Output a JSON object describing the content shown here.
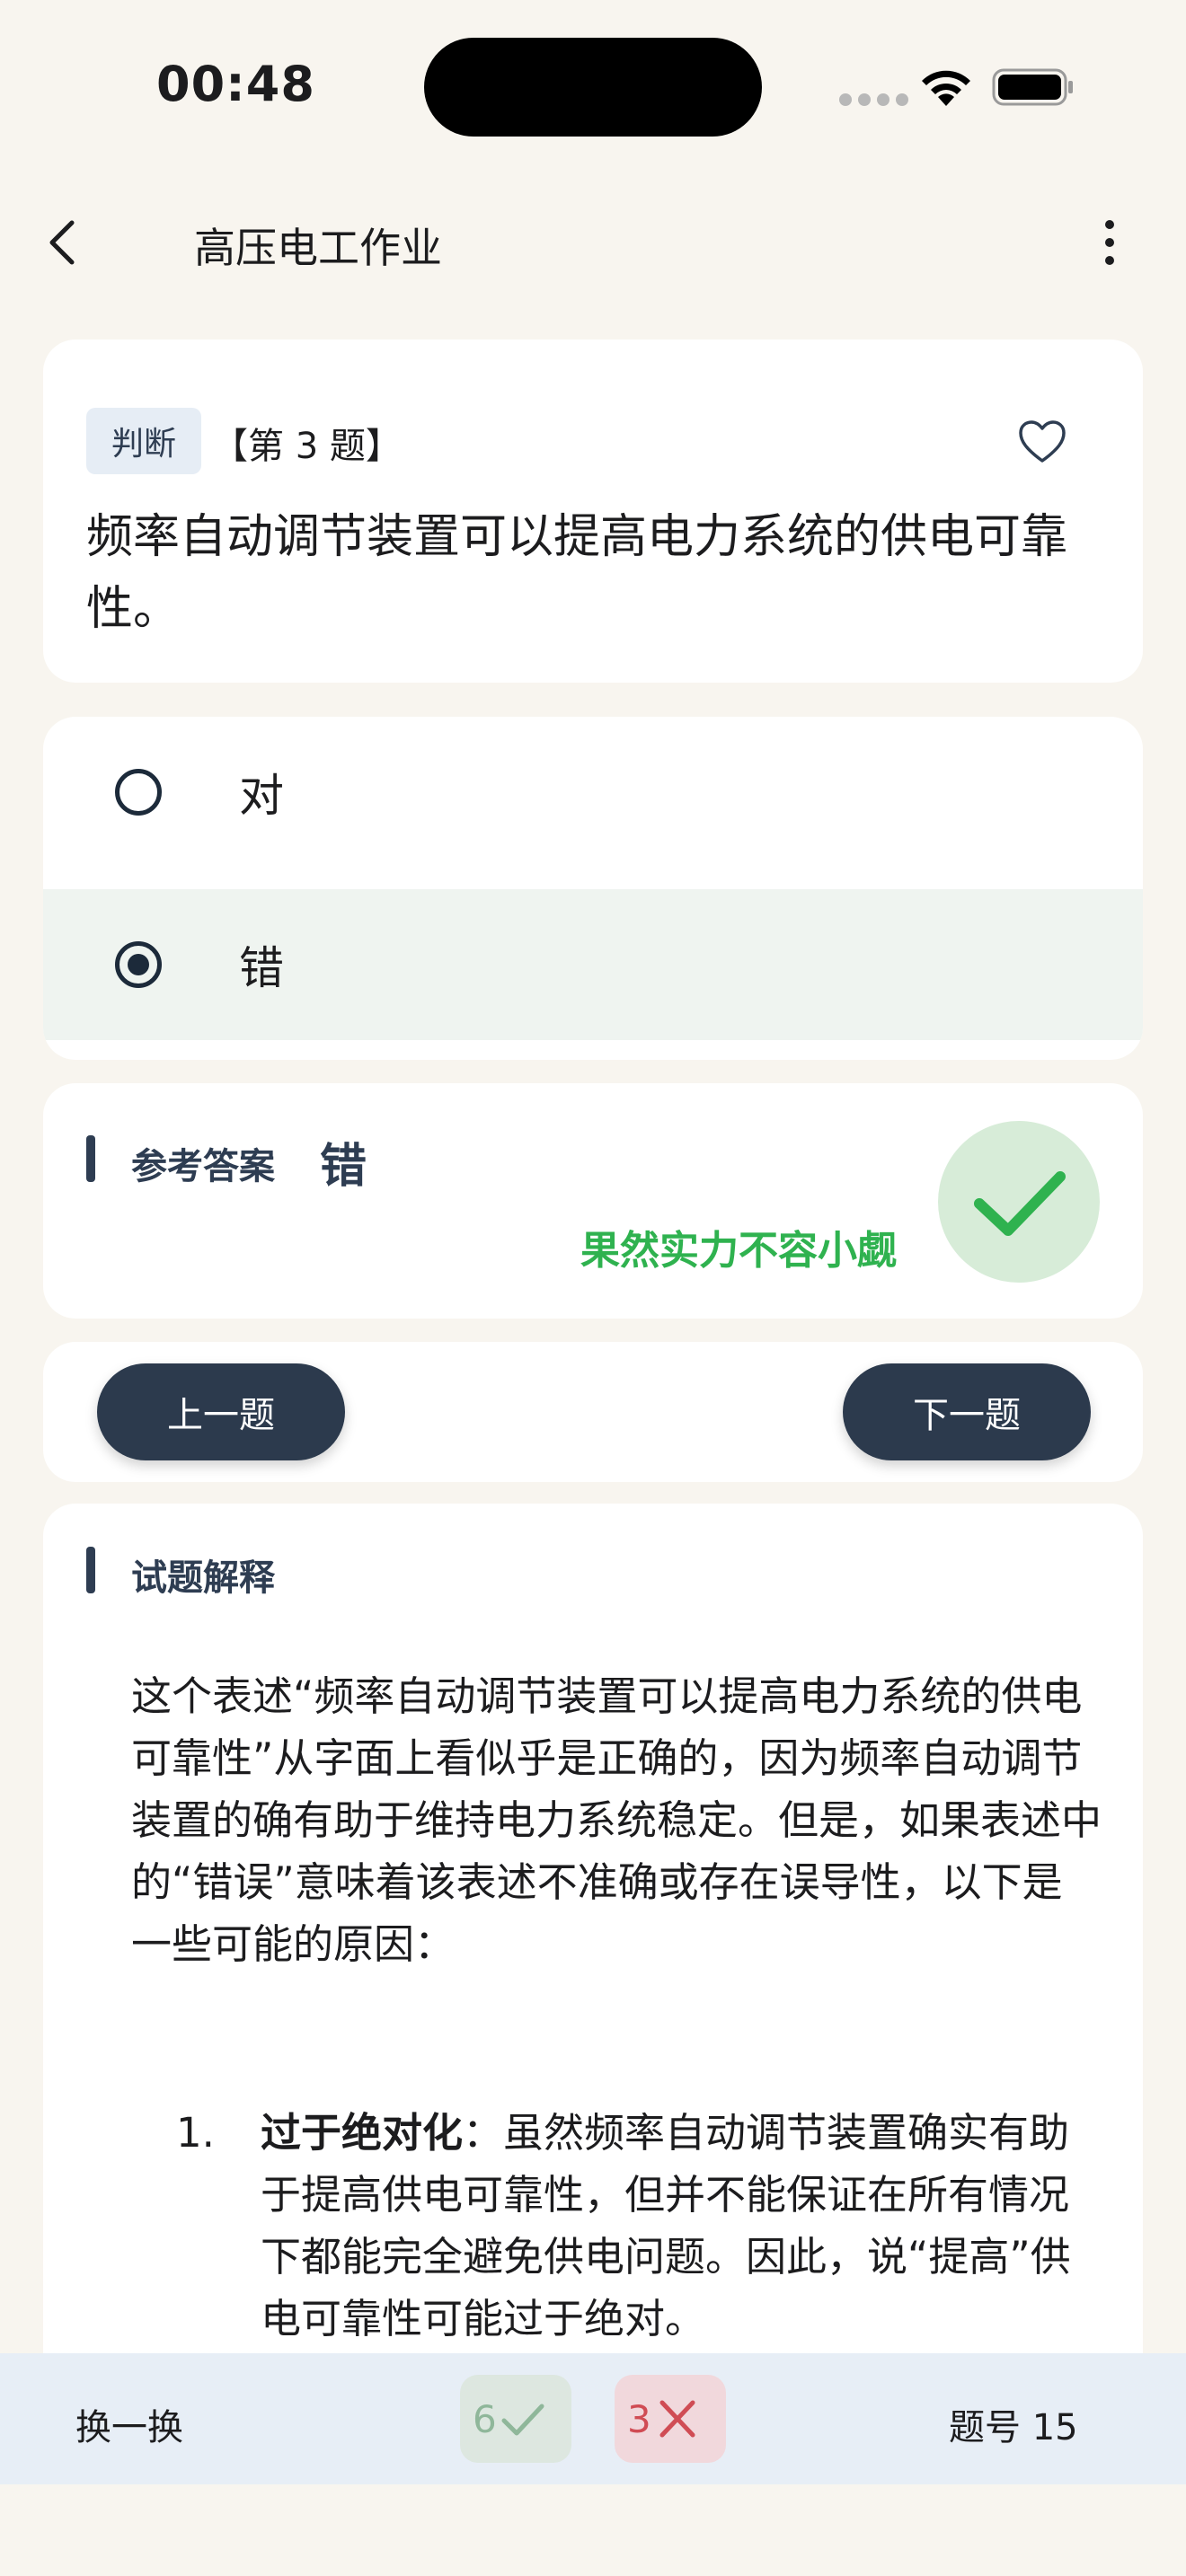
{
  "status": {
    "time": "00:48"
  },
  "header": {
    "title": "高压电工作业"
  },
  "question": {
    "type_tag": "判断",
    "number_label": "【第 3 题】",
    "text": "频率自动调节装置可以提高电力系统的供电可靠性。"
  },
  "options": [
    {
      "label": "对",
      "selected": false
    },
    {
      "label": "错",
      "selected": true
    }
  ],
  "answer": {
    "label": "参考答案",
    "value": "错",
    "feedback": "果然实力不容小觑"
  },
  "navigation": {
    "prev_label": "上一题",
    "next_label": "下一题"
  },
  "explanation": {
    "label": "试题解释",
    "paragraph": "这个表述“频率自动调节装置可以提高电力系统的供电可靠性”从字面上看似乎是正确的，因为频率自动调节装置的确有助于维持电力系统稳定。但是，如果表述中的“错误”意味着该表述不准确或存在误导性，以下是一些可能的原因：",
    "items": [
      {
        "number": "1.",
        "title": "过于绝对化",
        "text": "：虽然频率自动调节装置确实有助于提高供电可靠性，但并不能保证在所有情况下都能完全避免供电问题。因此，说“提高”供电可靠性可能过于绝对。"
      }
    ]
  },
  "bottom_bar": {
    "swap_label": "换一换",
    "correct_count": "6",
    "wrong_count": "3",
    "question_no_label": "题号 15"
  },
  "colors": {
    "background": "#f8f5ef",
    "primary_dark": "#2c3a4d",
    "success_green": "#2fb24f",
    "error_red": "#d04c54"
  }
}
